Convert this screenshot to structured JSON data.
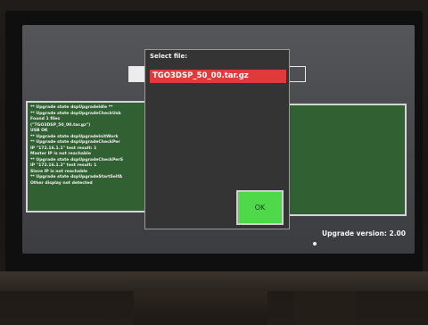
{
  "dialog": {
    "title": "Select file:",
    "files": [
      {
        "name": "TGO3DSP_50_00.tar.gz",
        "selected": true
      }
    ],
    "ok_label": "OK"
  },
  "console": {
    "lines": [
      "** Upgrade state dspUpgradeIdle **",
      "** Upgrade state dspUpgradeCheckUsb",
      "Found 1 files",
      "(\"TGO3DSP_50_00.tar.gz\")",
      "USB OK",
      "** Upgrade state dspUpgradeInitWork",
      "** Upgrade state dspUpgradeCheckPer",
      "IP \"172.16.1.1\" test result: 1",
      "Master IP is not reachable",
      "** Upgrade state dspUpgradeCheckPerS",
      "IP \"172.16.1.2\" test result: 1",
      "Slave IP is not reachable",
      "** Upgrade state dspUpgradeStartSelfA",
      "Other display not detected"
    ]
  },
  "status": {
    "upgrade_version": "Upgrade version: 2.00"
  },
  "colors": {
    "console_bg": "#316032",
    "selected_file_bg": "#e03a3a",
    "ok_button_bg": "#4fd84a",
    "dialog_bg": "#343434"
  }
}
